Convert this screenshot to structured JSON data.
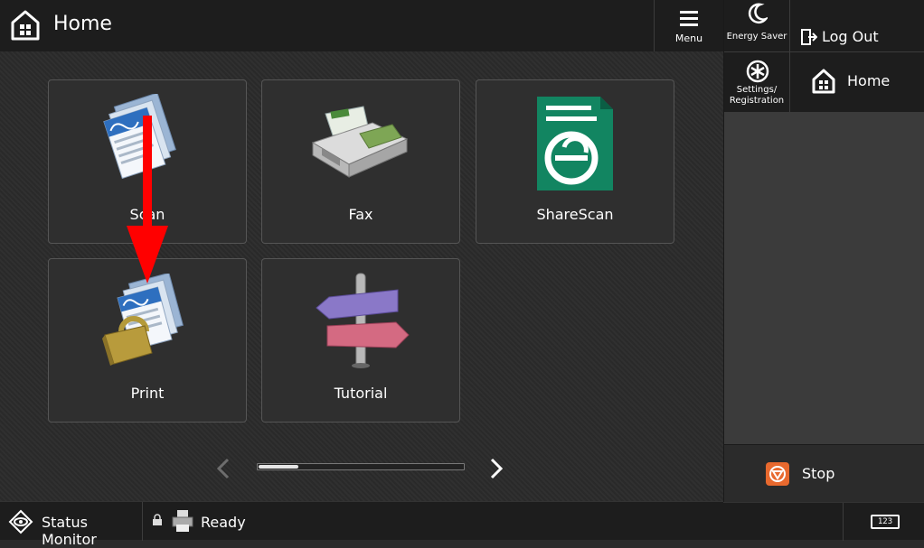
{
  "header": {
    "title": "Home",
    "menu_label": "Menu"
  },
  "tiles": [
    {
      "label": "Scan"
    },
    {
      "label": "Fax"
    },
    {
      "label": "ShareScan"
    },
    {
      "label": "Print"
    },
    {
      "label": "Tutorial"
    }
  ],
  "side_panel": {
    "energy_saver_label": "Energy Saver",
    "logout_label": "Log Out",
    "settings_line1": "Settings/",
    "settings_line2": "Registration",
    "home_label": "Home",
    "stop_label": "Stop",
    "keypad_label": "123"
  },
  "status_bar": {
    "status_monitor_label": "Status Monitor",
    "ready_label": "Ready"
  },
  "colors": {
    "stop": "#e8692e",
    "sharescan_green": "#128561",
    "annotation_arrow": "#ff0000"
  }
}
